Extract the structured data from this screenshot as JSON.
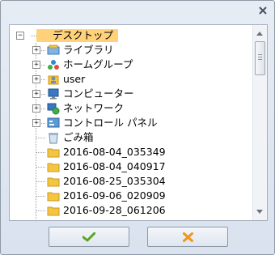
{
  "tree": {
    "root": {
      "label": "デスクトップ",
      "icon": "desktop-folder-icon",
      "expander": "−"
    },
    "items": [
      {
        "label": "ライブラリ",
        "icon": "library-icon",
        "expander": "+"
      },
      {
        "label": "ホームグループ",
        "icon": "homegroup-icon",
        "expander": "+"
      },
      {
        "label": "user",
        "icon": "user-folder-icon",
        "expander": "+"
      },
      {
        "label": "コンピューター",
        "icon": "computer-icon",
        "expander": "+"
      },
      {
        "label": "ネットワーク",
        "icon": "network-icon",
        "expander": "+"
      },
      {
        "label": "コントロール パネル",
        "icon": "control-panel-icon",
        "expander": "+"
      },
      {
        "label": "ごみ箱",
        "icon": "recycle-bin-icon",
        "expander": ""
      },
      {
        "label": "2016-08-04_035349",
        "icon": "folder-icon",
        "expander": ""
      },
      {
        "label": "2016-08-04_040917",
        "icon": "folder-icon",
        "expander": ""
      },
      {
        "label": "2016-08-25_035304",
        "icon": "folder-icon",
        "expander": ""
      },
      {
        "label": "2016-09-06_020909",
        "icon": "folder-icon",
        "expander": ""
      },
      {
        "label": "2016-09-28_061206",
        "icon": "folder-icon",
        "expander": ""
      }
    ]
  },
  "buttons": {
    "ok_icon": "checkmark-icon",
    "cancel_icon": "cross-icon",
    "ok_color": "#5aa51e",
    "cancel_color": "#f0961e"
  },
  "colors": {
    "selection": "#ffd27a",
    "folder": "#f5c542"
  }
}
